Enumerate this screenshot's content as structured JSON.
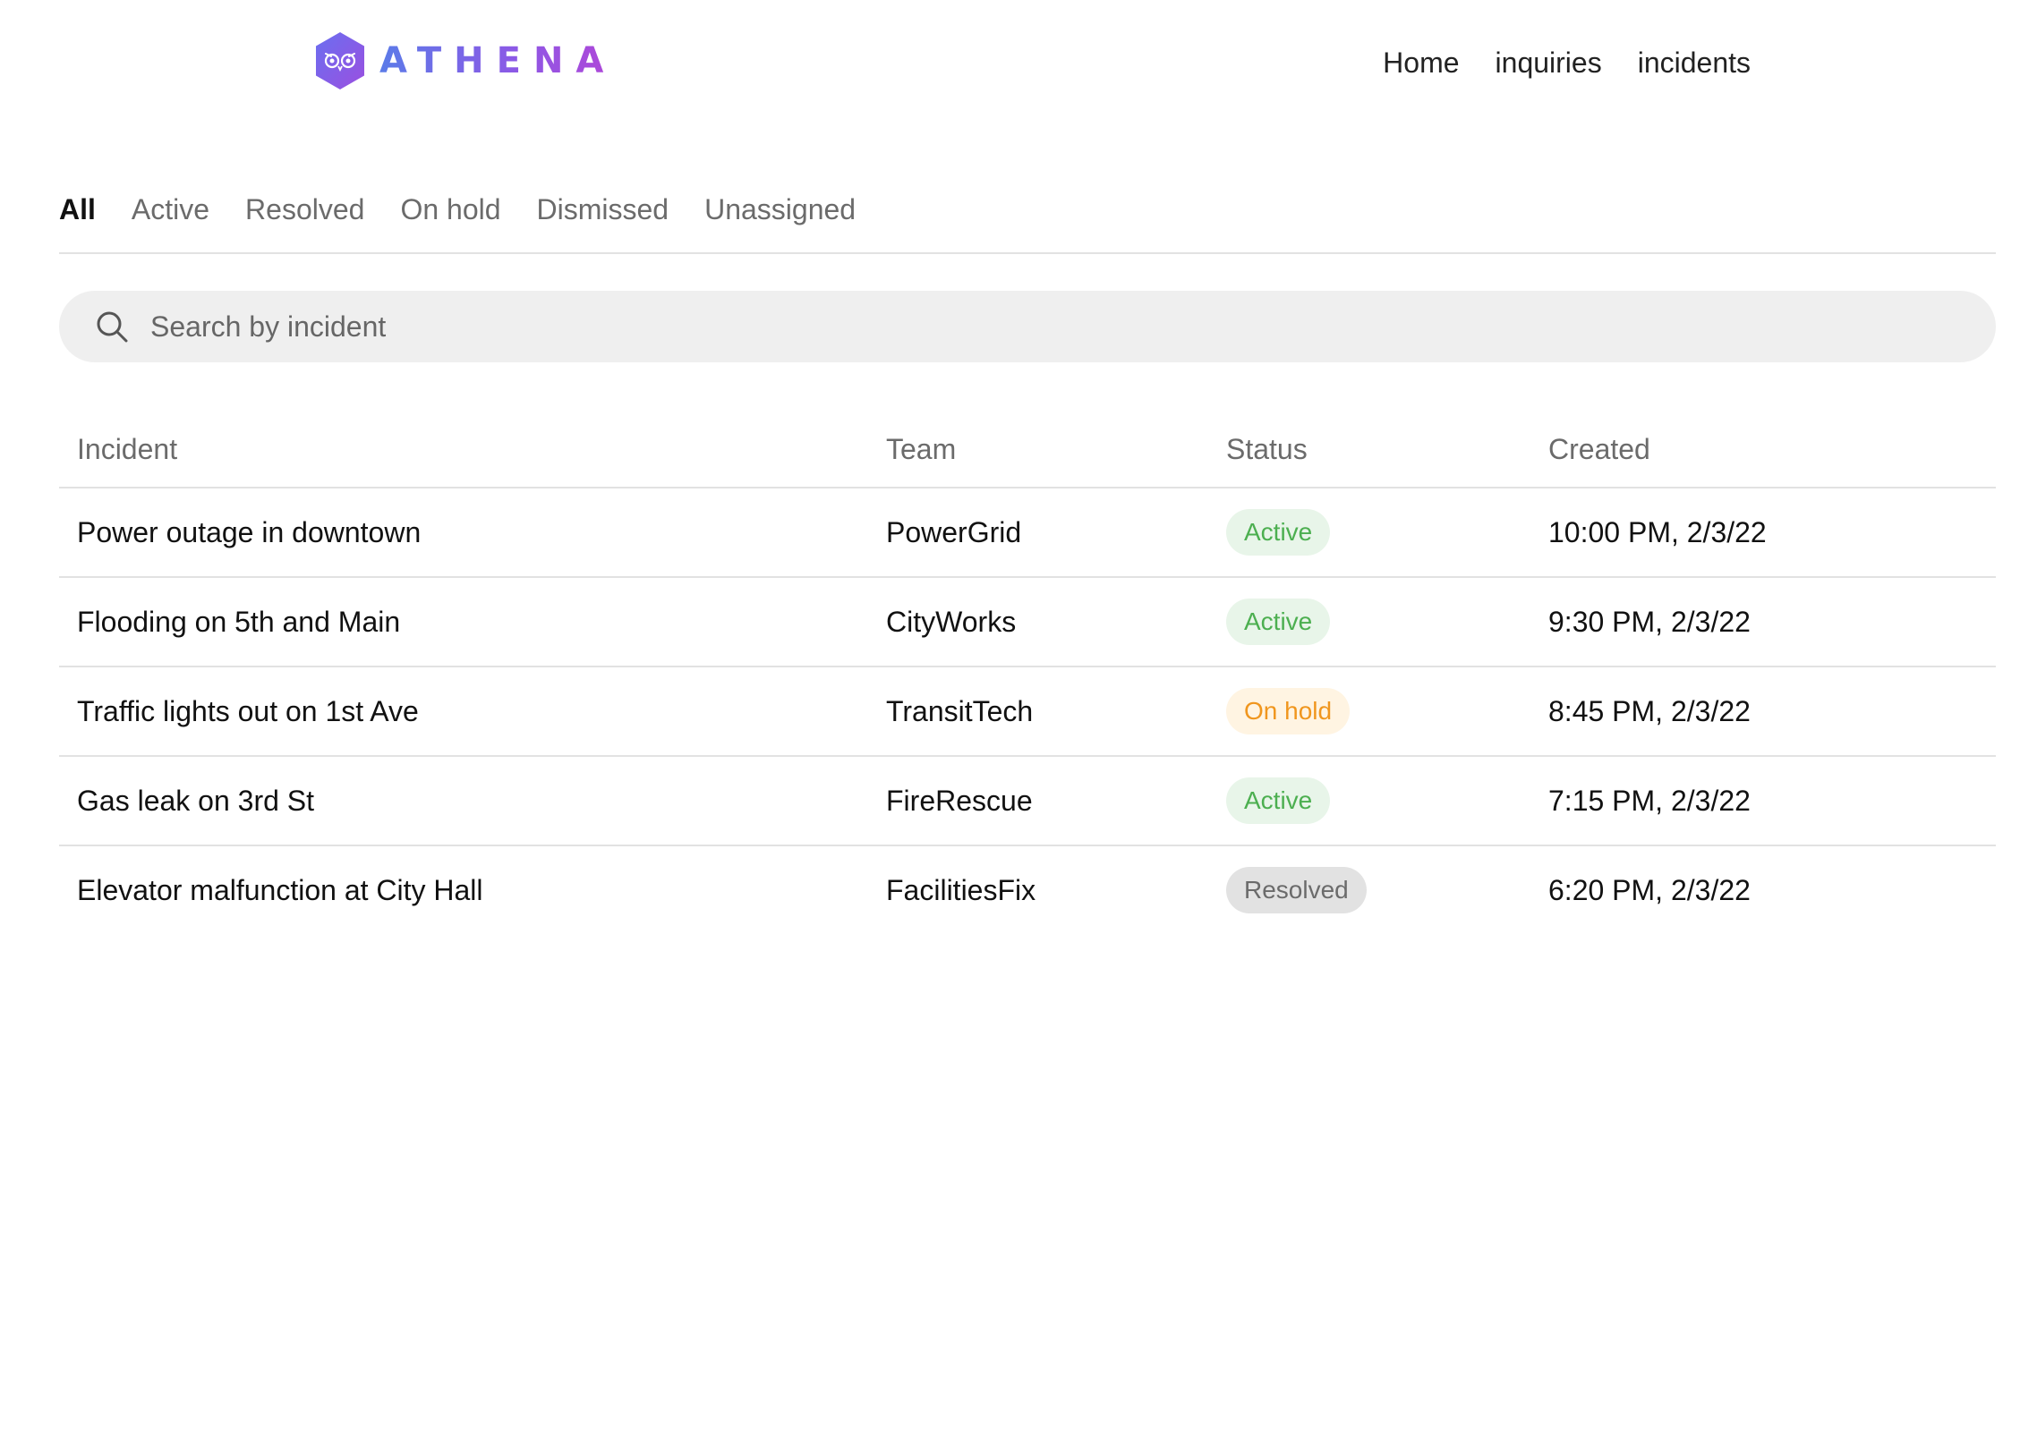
{
  "brand": {
    "name": "ATHENA"
  },
  "nav": {
    "items": [
      "Home",
      "inquiries",
      "incidents"
    ]
  },
  "filters": {
    "tabs": [
      "All",
      "Active",
      "Resolved",
      "On hold",
      "Dismissed",
      "Unassigned"
    ],
    "selected": "All"
  },
  "search": {
    "placeholder": "Search by incident",
    "value": "",
    "icon": "search-icon"
  },
  "table": {
    "columns": [
      "Incident",
      "Team",
      "Status",
      "Created"
    ],
    "rows": [
      {
        "incident": "Power outage in downtown",
        "team": "PowerGrid",
        "status": "Active",
        "created": "10:00 PM, 2/3/22"
      },
      {
        "incident": "Flooding on 5th and Main",
        "team": "CityWorks",
        "status": "Active",
        "created": "9:30 PM, 2/3/22"
      },
      {
        "incident": "Traffic lights out on 1st Ave",
        "team": "TransitTech",
        "status": "On hold",
        "created": "8:45 PM, 2/3/22"
      },
      {
        "incident": "Gas leak on 3rd St",
        "team": "FireRescue",
        "status": "Active",
        "created": "7:15 PM, 2/3/22"
      },
      {
        "incident": "Elevator malfunction at City Hall",
        "team": "FacilitiesFix",
        "status": "Resolved",
        "created": "6:20 PM, 2/3/22"
      }
    ]
  },
  "status_colors": {
    "Active": {
      "bg": "#e8f5e9",
      "fg": "#4caf50"
    },
    "On hold": {
      "bg": "#fff4e2",
      "fg": "#f0961e"
    },
    "Resolved": {
      "bg": "#e2e2e2",
      "fg": "#6b6b6b"
    }
  },
  "colors": {
    "brand_start": "#5b7be8",
    "brand_end": "#b046d8"
  }
}
